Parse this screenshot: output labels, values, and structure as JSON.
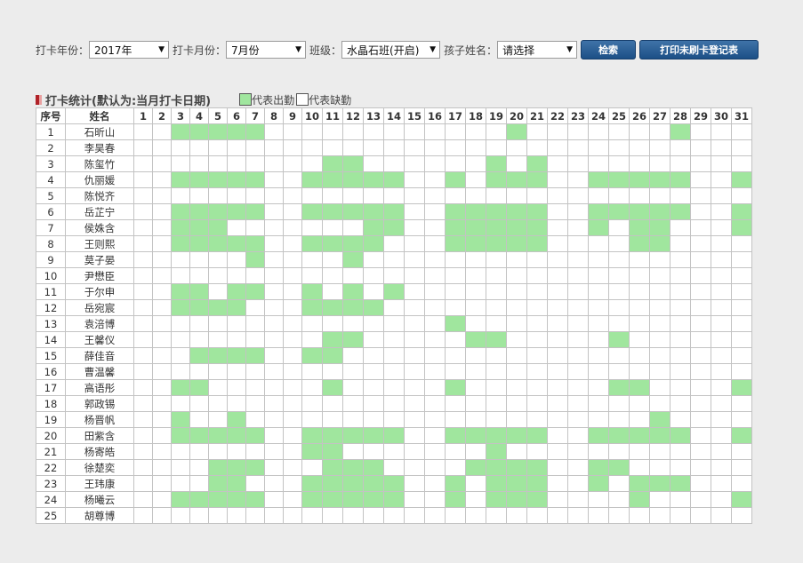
{
  "filters": {
    "year_label": "打卡年份：",
    "year_value": "2017年",
    "month_label": "打卡月份：",
    "month_value": "7月份",
    "class_label": "班级：",
    "class_value": "水晶石班(开启)",
    "child_label": "孩子姓名：",
    "child_value": "请选择",
    "search_button": "检索",
    "print_button": "打印未刷卡登记表"
  },
  "section": {
    "title": "打卡统计(默认为:当月打卡日期)",
    "legend_present": "代表出勤",
    "legend_absent": "代表缺勤",
    "present_color": "#a0e69e"
  },
  "table": {
    "headers": {
      "index": "序号",
      "name": "姓名",
      "days": [
        "1",
        "2",
        "3",
        "4",
        "5",
        "6",
        "7",
        "8",
        "9",
        "10",
        "11",
        "12",
        "13",
        "14",
        "15",
        "16",
        "17",
        "18",
        "19",
        "20",
        "21",
        "22",
        "23",
        "24",
        "25",
        "26",
        "27",
        "28",
        "29",
        "30",
        "31"
      ]
    },
    "rows": [
      {
        "index": "1",
        "name": "石昕山",
        "present": [
          3,
          4,
          5,
          6,
          7,
          20,
          28
        ]
      },
      {
        "index": "2",
        "name": "李昊春",
        "present": []
      },
      {
        "index": "3",
        "name": "陈玺竹",
        "present": [
          11,
          12,
          19,
          21
        ]
      },
      {
        "index": "4",
        "name": "仇丽媛",
        "present": [
          3,
          4,
          5,
          6,
          7,
          10,
          11,
          12,
          13,
          14,
          17,
          19,
          20,
          21,
          24,
          25,
          26,
          27,
          28,
          31
        ]
      },
      {
        "index": "5",
        "name": "陈悦齐",
        "present": []
      },
      {
        "index": "6",
        "name": "岳芷宁",
        "present": [
          3,
          4,
          5,
          6,
          7,
          10,
          11,
          12,
          13,
          14,
          17,
          18,
          19,
          20,
          21,
          24,
          25,
          26,
          27,
          28,
          31
        ]
      },
      {
        "index": "7",
        "name": "侯姝含",
        "present": [
          3,
          4,
          5,
          13,
          14,
          17,
          18,
          19,
          20,
          21,
          24,
          26,
          27,
          31
        ]
      },
      {
        "index": "8",
        "name": "王则熙",
        "present": [
          3,
          4,
          5,
          6,
          7,
          10,
          11,
          12,
          13,
          17,
          18,
          19,
          20,
          21,
          26,
          27
        ]
      },
      {
        "index": "9",
        "name": "莫子晏",
        "present": [
          7,
          12
        ]
      },
      {
        "index": "10",
        "name": "尹懋臣",
        "present": []
      },
      {
        "index": "11",
        "name": "于尔申",
        "present": [
          3,
          4,
          6,
          7,
          10,
          12,
          14
        ]
      },
      {
        "index": "12",
        "name": "岳宛宸",
        "present": [
          3,
          4,
          5,
          6,
          10,
          11,
          12,
          13
        ]
      },
      {
        "index": "13",
        "name": "袁涪博",
        "present": [
          17
        ]
      },
      {
        "index": "14",
        "name": "王馨仪",
        "present": [
          11,
          12,
          18,
          19,
          25
        ]
      },
      {
        "index": "15",
        "name": "薛佳音",
        "present": [
          4,
          5,
          6,
          7,
          10,
          11
        ]
      },
      {
        "index": "16",
        "name": "曹温馨",
        "present": []
      },
      {
        "index": "17",
        "name": "高语彤",
        "present": [
          3,
          4,
          11,
          17,
          25,
          26,
          31
        ]
      },
      {
        "index": "18",
        "name": "郭政锡",
        "present": []
      },
      {
        "index": "19",
        "name": "杨晋帆",
        "present": [
          3,
          6,
          27
        ]
      },
      {
        "index": "20",
        "name": "田紫含",
        "present": [
          3,
          4,
          5,
          6,
          7,
          10,
          11,
          12,
          13,
          14,
          17,
          18,
          19,
          20,
          21,
          24,
          25,
          26,
          27,
          28,
          31
        ]
      },
      {
        "index": "21",
        "name": "杨寄皓",
        "present": [
          10,
          11,
          19
        ]
      },
      {
        "index": "22",
        "name": "徐楚奕",
        "present": [
          5,
          6,
          7,
          11,
          12,
          13,
          18,
          19,
          20,
          21,
          24,
          25
        ]
      },
      {
        "index": "23",
        "name": "王玮康",
        "present": [
          5,
          6,
          10,
          11,
          12,
          13,
          14,
          17,
          19,
          20,
          21,
          24,
          26,
          27,
          28
        ]
      },
      {
        "index": "24",
        "name": "杨曦云",
        "present": [
          3,
          4,
          5,
          6,
          7,
          10,
          11,
          12,
          13,
          14,
          17,
          19,
          20,
          21,
          26,
          31
        ]
      },
      {
        "index": "25",
        "name": "胡尊博",
        "present": []
      }
    ]
  }
}
